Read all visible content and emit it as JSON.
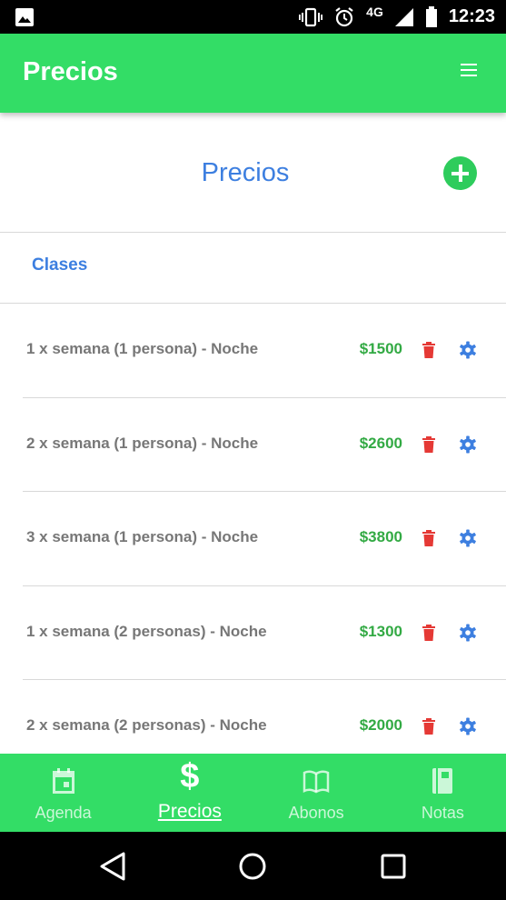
{
  "status_bar": {
    "time": "12:23",
    "network": "4G"
  },
  "app_bar": {
    "title": "Precios"
  },
  "header": {
    "heading": "Precios"
  },
  "section": {
    "label": "Clases"
  },
  "prices": [
    {
      "name": "1 x semana (1 persona) - Noche",
      "price": "$1500"
    },
    {
      "name": "2 x semana (1 persona) - Noche",
      "price": "$2600"
    },
    {
      "name": "3 x semana (1 persona) - Noche",
      "price": "$3800"
    },
    {
      "name": "1 x semana (2 personas) - Noche",
      "price": "$1300"
    },
    {
      "name": "2 x semana (2 personas) - Noche",
      "price": "$2000"
    }
  ],
  "bottom_nav": {
    "agenda": "Agenda",
    "precios": "Precios",
    "abonos": "Abonos",
    "notas": "Notas",
    "dollar_glyph": "$"
  },
  "colors": {
    "primary_green": "#33dd66",
    "accent_blue": "#3d7fe0",
    "price_green": "#33aa44",
    "delete_red": "#e53935"
  }
}
